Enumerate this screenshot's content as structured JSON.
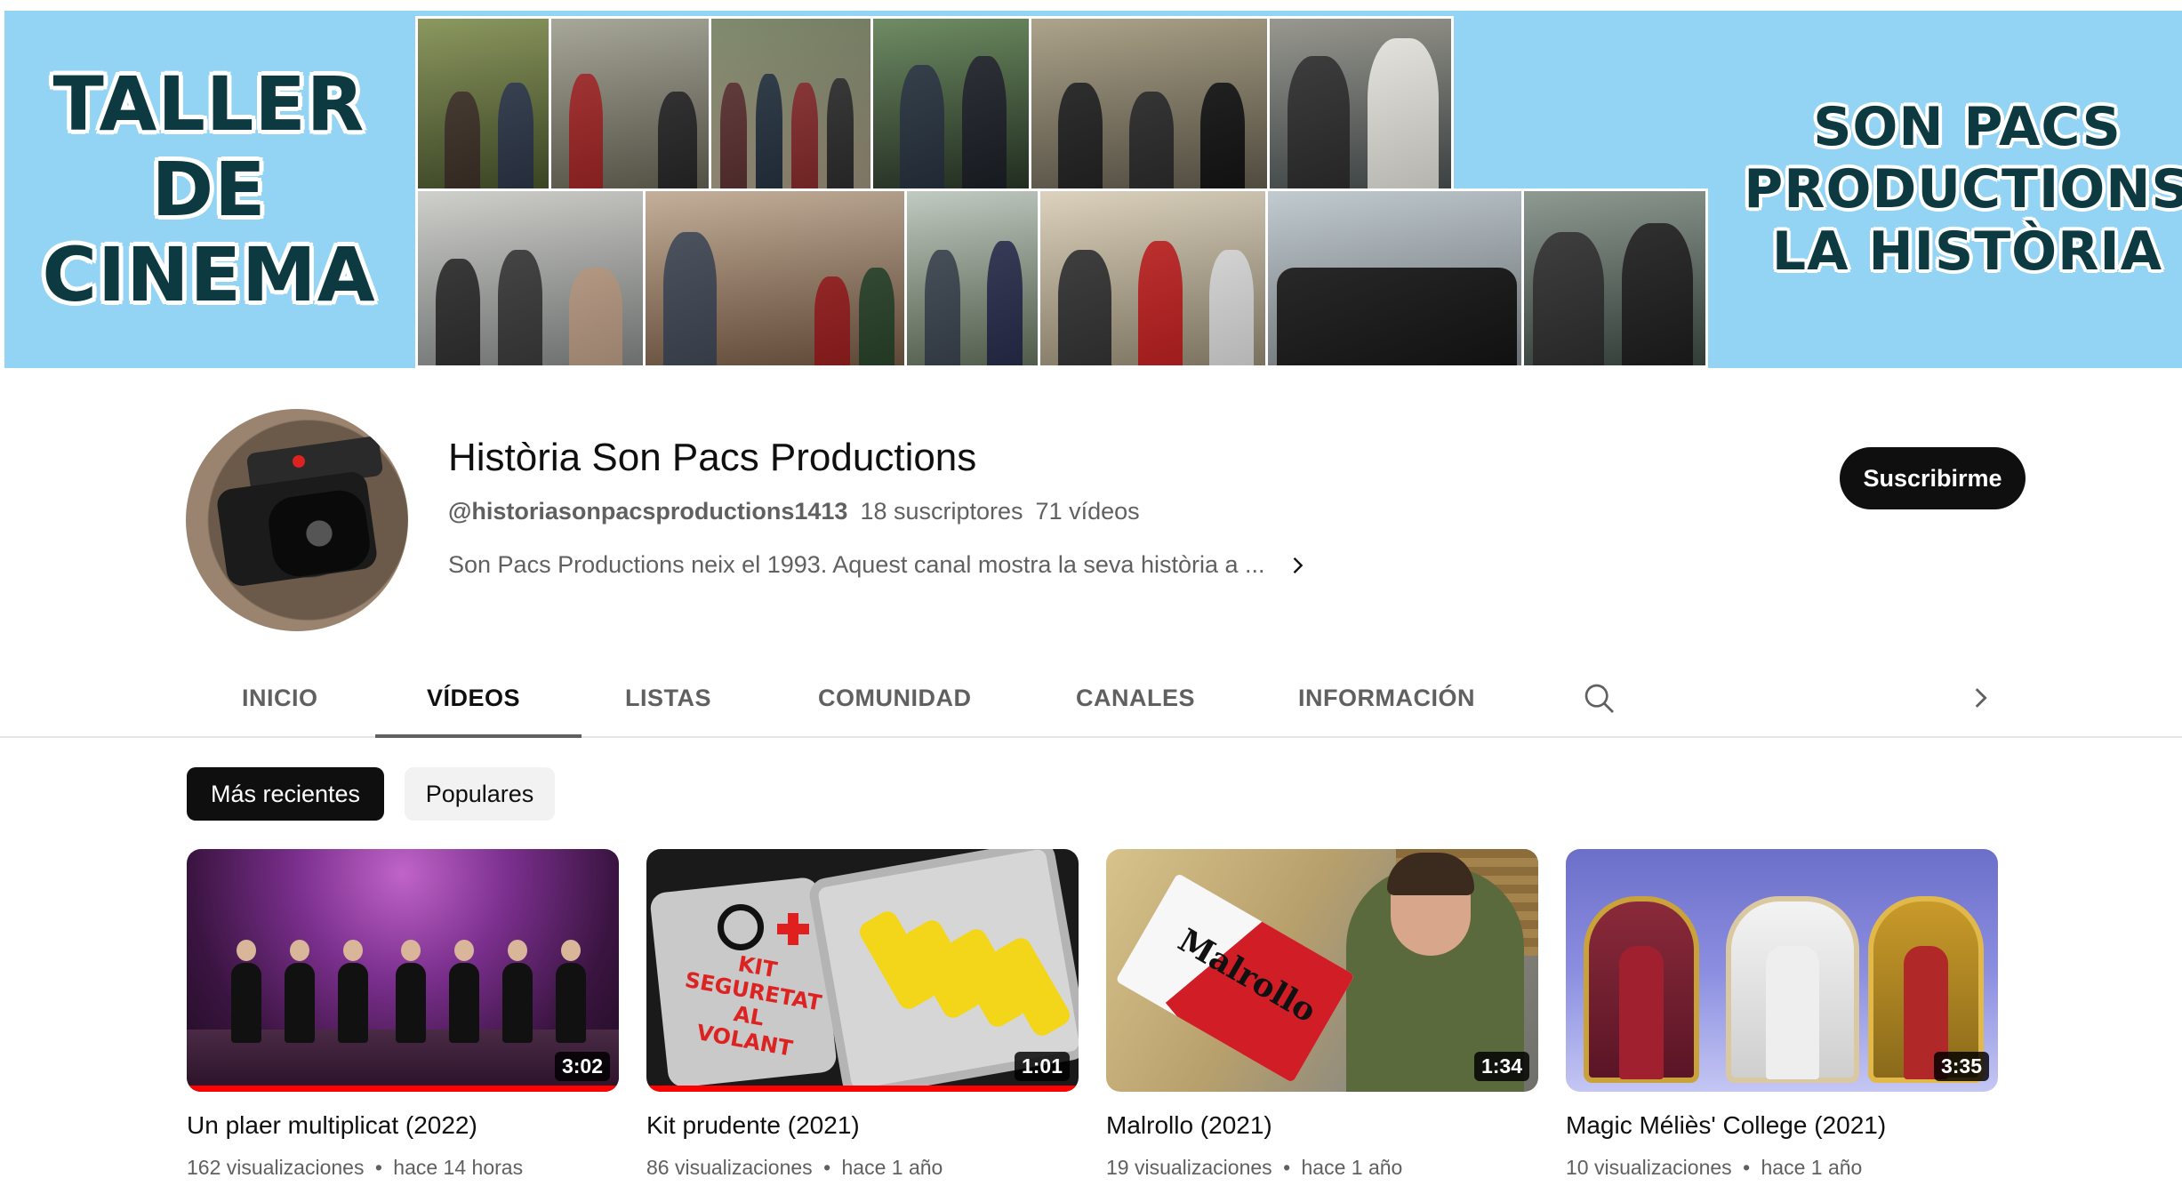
{
  "banner": {
    "left_lines": [
      "TALLER",
      "DE",
      "CINEMA"
    ],
    "right_lines": [
      "SON PACS",
      "PRODUCTIONS",
      "LA HISTÒRIA"
    ]
  },
  "channel": {
    "name": "Història Son Pacs Productions",
    "handle": "@historiasonpacsproductions1413",
    "subscribers": "18 suscriptores",
    "video_count": "71 vídeos",
    "description": "Son Pacs Productions neix el 1993. Aquest canal mostra la seva història a ...",
    "subscribe_label": "Suscribirme"
  },
  "tabs": [
    {
      "label": "INICIO",
      "active": false
    },
    {
      "label": "VÍDEOS",
      "active": true
    },
    {
      "label": "LISTAS",
      "active": false
    },
    {
      "label": "COMUNIDAD",
      "active": false
    },
    {
      "label": "CANALES",
      "active": false
    },
    {
      "label": "INFORMACIÓN",
      "active": false
    }
  ],
  "chips": [
    {
      "label": "Más recientes",
      "active": true
    },
    {
      "label": "Populares",
      "active": false
    }
  ],
  "videos": [
    {
      "title": "Un plaer multiplicat (2022)",
      "views": "162 visualizaciones",
      "age": "hace 14 horas",
      "duration": "3:02",
      "watched_fraction": 1.0
    },
    {
      "title": "Kit prudente (2021)",
      "views": "86 visualizaciones",
      "age": "hace 1 año",
      "duration": "1:01",
      "watched_fraction": 1.0
    },
    {
      "title": "Malrollo (2021)",
      "views": "19 visualizaciones",
      "age": "hace 1 año",
      "duration": "1:34",
      "watched_fraction": 0.0
    },
    {
      "title": "Magic Méliès' College (2021)",
      "views": "10 visualizaciones",
      "age": "hace 1 año",
      "duration": "3:35",
      "watched_fraction": 0.0
    }
  ],
  "thumb_text": {
    "kit_lines": "KIT\nSEGURETAT\nAL\nVOLANT",
    "malrollo_pack": "Malrollo"
  },
  "meta_separator": "•",
  "icons": {
    "search": "search-icon",
    "next": "chevron-right-icon",
    "description_more": "chevron-right-icon"
  },
  "colors": {
    "banner_bg": "#93d4f5",
    "subscribe_bg": "#0f0f0f",
    "progress": "#ff0000",
    "muted_text": "#606060"
  }
}
